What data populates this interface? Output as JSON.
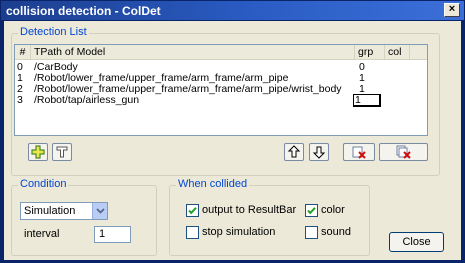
{
  "window": {
    "title": "collision detection - ColDet",
    "close_glyph": "×"
  },
  "detection_list": {
    "title": "Detection List",
    "columns": [
      "#",
      "TPath of Model",
      "grp",
      "col"
    ],
    "rows": [
      {
        "num": "0",
        "path": "/CarBody",
        "grp": "0",
        "col": ""
      },
      {
        "num": "1",
        "path": "/Robot/lower_frame/upper_frame/arm_frame/arm_pipe",
        "grp": "1",
        "col": ""
      },
      {
        "num": "2",
        "path": "/Robot/lower_frame/upper_frame/arm_frame/arm_pipe/wrist_body",
        "grp": "1",
        "col": ""
      },
      {
        "num": "3",
        "path": "/Robot/tap/airless_gun",
        "grp": "1",
        "col": ""
      }
    ],
    "editing_value": "1",
    "buttons": {
      "add_icon": "plus-icon",
      "path_icon": "tpath-icon",
      "up_icon": "arrow-up-icon",
      "down_icon": "arrow-down-icon",
      "remove_icon": "remove-icon",
      "remove_all_icon": "remove-all-icon"
    }
  },
  "condition": {
    "title": "Condition",
    "mode_selected": "Simulation",
    "interval_label": "interval",
    "interval_value": "1"
  },
  "when_collided": {
    "title": "When collided",
    "output_label": "output to ResultBar",
    "output_checked": true,
    "color_label": "color",
    "color_checked": true,
    "stop_label": "stop simulation",
    "stop_checked": false,
    "sound_label": "sound",
    "sound_checked": false
  },
  "close_button": "Close",
  "colors": {
    "group_title": "#0046d5",
    "titlebar": "#2a5cc4",
    "dialog_bg": "#ece9d8"
  }
}
